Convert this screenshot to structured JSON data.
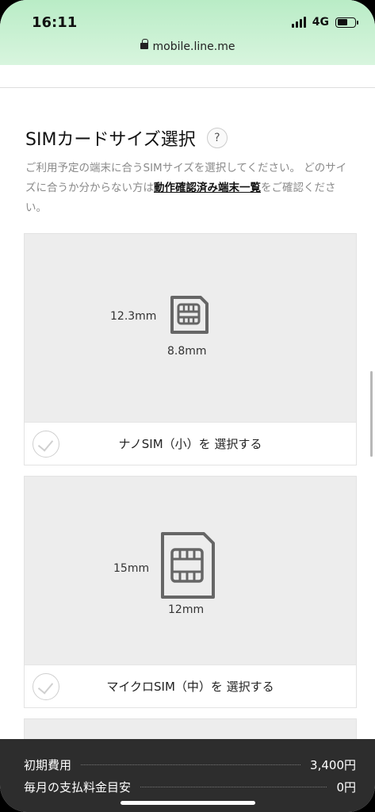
{
  "status": {
    "time": "16:11",
    "network": "4G"
  },
  "browser": {
    "url": "mobile.line.me"
  },
  "section": {
    "title": "SIMカードサイズ選択",
    "help": "?",
    "desc_text": "ご利用予定の端末に合うSIMサイズを選択してください。 どのサイズに合うか分からない方は",
    "desc_link": "動作確認済み端末一覧",
    "desc_suffix": "をご確認ください。"
  },
  "sim_options": [
    {
      "height": "12.3mm",
      "width": "8.8mm",
      "select_label": "ナノSIM（小）を 選択する"
    },
    {
      "height": "15mm",
      "width": "12mm",
      "select_label": "マイクロSIM（中）を 選択する"
    }
  ],
  "costs": {
    "initial_label": "初期費用",
    "initial_value": "3,400円",
    "monthly_label": "毎月の支払料金目安",
    "monthly_value": "0円"
  }
}
